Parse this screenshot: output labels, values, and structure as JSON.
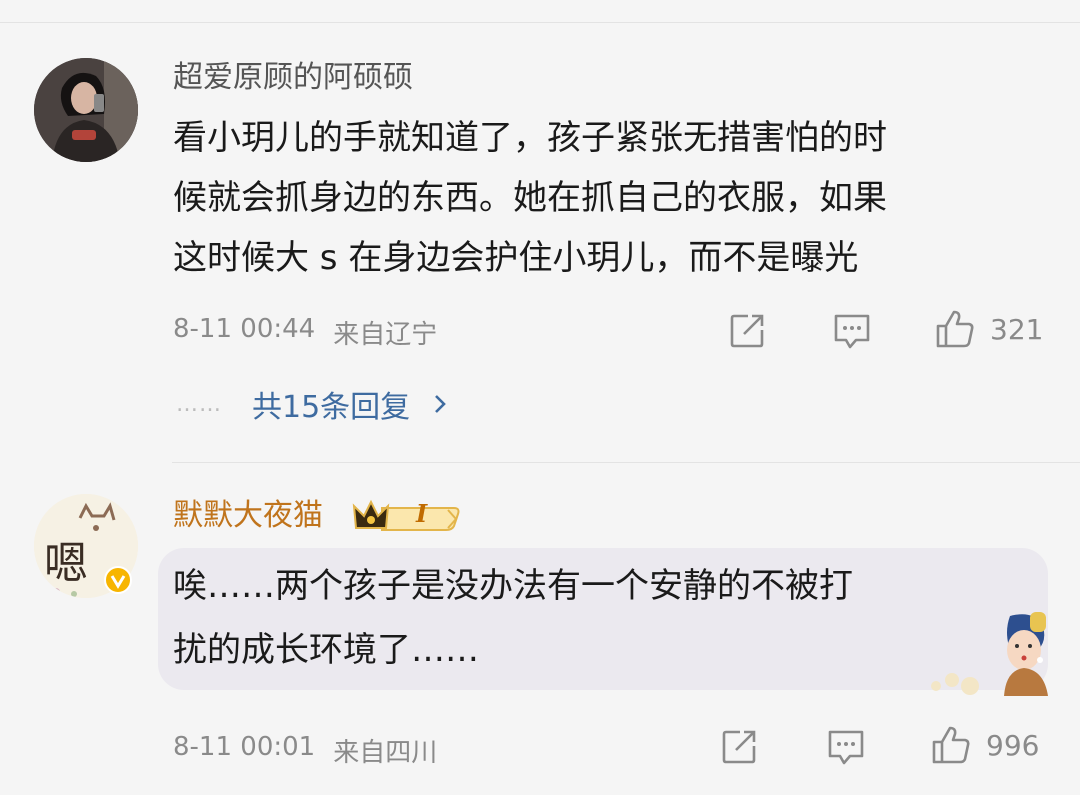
{
  "comments": [
    {
      "username": "超爱原顾的阿硕硕",
      "username_color": "#555555",
      "lines": [
        "看小玥儿的手就知道了，孩子紧张无措害怕的时",
        "候就会抓身边的东西。她在抓自己的衣服，如果",
        "这时候大 s 在身边会护住小玥儿，而不是曝光"
      ],
      "time": "8-11 00:44",
      "location": "来自辽宁",
      "like_count": "321",
      "replies_label": "共15条回复",
      "replies_dots": "……"
    },
    {
      "username": "默默大夜猫",
      "username_color": "#c0741c",
      "badge_level": "I",
      "lines": [
        "唉……两个孩子是没办法有一个安静的不被打",
        "扰的成长环境了……"
      ],
      "time": "8-11 00:01",
      "location": "来自四川",
      "like_count": "996"
    }
  ]
}
